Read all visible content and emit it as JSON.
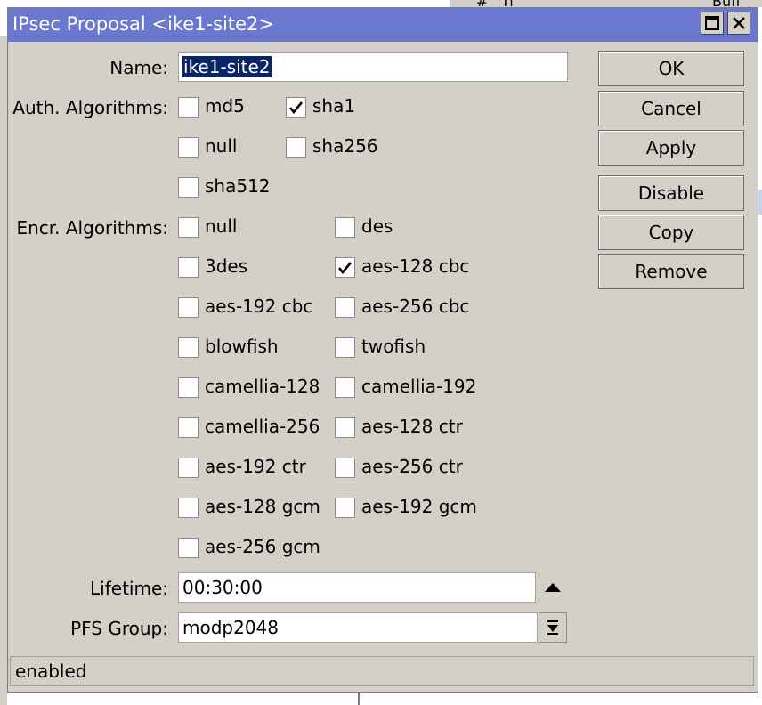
{
  "window": {
    "title": "IPsec Proposal <ike1-site2>",
    "maximize_icon": "maximize-icon",
    "close_icon": "close-icon"
  },
  "name": {
    "label": "Name:",
    "value": "ike1-site2"
  },
  "auth": {
    "label": "Auth. Algorithms:",
    "options": [
      {
        "label": "md5",
        "checked": false
      },
      {
        "label": "sha1",
        "checked": true
      },
      {
        "label": "null",
        "checked": false
      },
      {
        "label": "sha256",
        "checked": false
      },
      {
        "label": "sha512",
        "checked": false
      }
    ]
  },
  "encr": {
    "label": "Encr. Algorithms:",
    "options": [
      {
        "label": "null",
        "checked": false
      },
      {
        "label": "des",
        "checked": false
      },
      {
        "label": "3des",
        "checked": false
      },
      {
        "label": "aes-128 cbc",
        "checked": true
      },
      {
        "label": "aes-192 cbc",
        "checked": false
      },
      {
        "label": "aes-256 cbc",
        "checked": false
      },
      {
        "label": "blowfish",
        "checked": false
      },
      {
        "label": "twofish",
        "checked": false
      },
      {
        "label": "camellia-128",
        "checked": false
      },
      {
        "label": "camellia-192",
        "checked": false
      },
      {
        "label": "camellia-256",
        "checked": false
      },
      {
        "label": "aes-128 ctr",
        "checked": false
      },
      {
        "label": "aes-192 ctr",
        "checked": false
      },
      {
        "label": "aes-256 ctr",
        "checked": false
      },
      {
        "label": "aes-128 gcm",
        "checked": false
      },
      {
        "label": "aes-192 gcm",
        "checked": false
      },
      {
        "label": "aes-256 gcm",
        "checked": false
      }
    ]
  },
  "lifetime": {
    "label": "Lifetime:",
    "value": "00:30:00",
    "icon": "collapse-up-icon"
  },
  "pfs": {
    "label": "PFS Group:",
    "value": "modp2048",
    "icon": "dropdown-icon"
  },
  "buttons": {
    "ok": "OK",
    "cancel": "Cancel",
    "apply": "Apply",
    "disable": "Disable",
    "copy": "Copy",
    "remove": "Remove"
  },
  "status": {
    "text": "enabled"
  },
  "background": {
    "col_hash": "#",
    "col_ti": "Ti",
    "col_buff": "Buff"
  }
}
